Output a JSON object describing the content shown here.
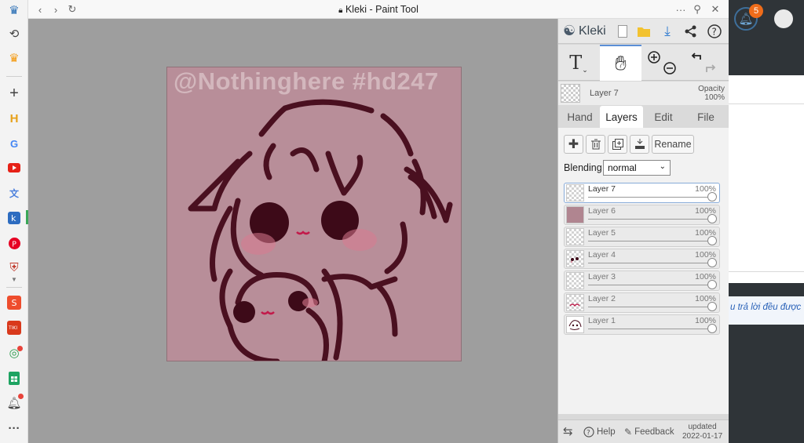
{
  "window": {
    "title": "Kleki - Paint Tool"
  },
  "canvas": {
    "watermark": "@Nothinghere #hd247"
  },
  "panel": {
    "logo_text": "Kleki",
    "current_layer": {
      "name": "Layer 7",
      "opacity_label": "Opacity",
      "opacity_value": "100%"
    },
    "tabs": [
      {
        "label": "Hand"
      },
      {
        "label": "Layers"
      },
      {
        "label": "Edit"
      },
      {
        "label": "File"
      }
    ],
    "rename_label": "Rename",
    "blending_label": "Blending",
    "blending_value": "normal",
    "layers": [
      {
        "name": "Layer 7",
        "opacity": "100%"
      },
      {
        "name": "Layer 6",
        "opacity": "100%"
      },
      {
        "name": "Layer 5",
        "opacity": "100%"
      },
      {
        "name": "Layer 4",
        "opacity": "100%"
      },
      {
        "name": "Layer 3",
        "opacity": "100%"
      },
      {
        "name": "Layer 2",
        "opacity": "100%"
      },
      {
        "name": "Layer 1",
        "opacity": "100%"
      }
    ],
    "footer": {
      "help": "Help",
      "feedback": "Feedback",
      "updated_label": "updated",
      "updated_date": "2022-01-17"
    }
  },
  "background_page": {
    "notification_count": "5",
    "snippet": "u trả lời đều được"
  },
  "colors": {
    "accent": "#5b8fd6",
    "canvas_bg": "#b88e99",
    "line_art": "#4a1020",
    "badge": "#ef6c1a"
  }
}
